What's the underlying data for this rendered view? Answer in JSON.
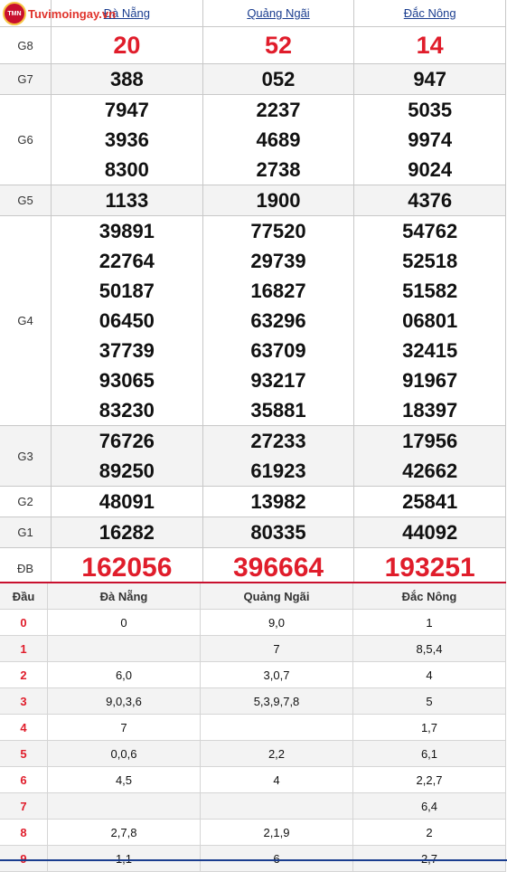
{
  "logo": {
    "text": "Tuvimoingay.vn",
    "badge": "TMN"
  },
  "provinces": [
    "Đà Nẵng",
    "Quảng Ngãi",
    "Đắc Nông"
  ],
  "prizes": [
    {
      "label": "G8",
      "values": [
        [
          "20"
        ],
        [
          "52"
        ],
        [
          "14"
        ]
      ]
    },
    {
      "label": "G7",
      "values": [
        [
          "388"
        ],
        [
          "052"
        ],
        [
          "947"
        ]
      ]
    },
    {
      "label": "G6",
      "values": [
        [
          "7947",
          "3936",
          "8300"
        ],
        [
          "2237",
          "4689",
          "2738"
        ],
        [
          "5035",
          "9974",
          "9024"
        ]
      ]
    },
    {
      "label": "G5",
      "values": [
        [
          "1133"
        ],
        [
          "1900"
        ],
        [
          "4376"
        ]
      ]
    },
    {
      "label": "G4",
      "values": [
        [
          "39891",
          "22764",
          "50187",
          "06450",
          "37739",
          "93065",
          "83230"
        ],
        [
          "77520",
          "29739",
          "16827",
          "63296",
          "63709",
          "93217",
          "35881"
        ],
        [
          "54762",
          "52518",
          "51582",
          "06801",
          "32415",
          "91967",
          "18397"
        ]
      ]
    },
    {
      "label": "G3",
      "values": [
        [
          "76726",
          "89250"
        ],
        [
          "27233",
          "61923"
        ],
        [
          "17956",
          "42662"
        ]
      ]
    },
    {
      "label": "G2",
      "values": [
        [
          "48091"
        ],
        [
          "13982"
        ],
        [
          "25841"
        ]
      ]
    },
    {
      "label": "G1",
      "values": [
        [
          "16282"
        ],
        [
          "80335"
        ],
        [
          "44092"
        ]
      ]
    },
    {
      "label": "ĐB",
      "values": [
        [
          "162056"
        ],
        [
          "396664"
        ],
        [
          "193251"
        ]
      ]
    }
  ],
  "loto": {
    "header": [
      "Đầu",
      "Đà Nẵng",
      "Quảng Ngãi",
      "Đắc Nông"
    ],
    "rows": [
      {
        "dau": "0",
        "values": [
          "0",
          "9,0",
          "1"
        ]
      },
      {
        "dau": "1",
        "values": [
          "",
          "7",
          "8,5,4"
        ]
      },
      {
        "dau": "2",
        "values": [
          "6,0",
          "3,0,7",
          "4"
        ]
      },
      {
        "dau": "3",
        "values": [
          "9,0,3,6",
          "5,3,9,7,8",
          "5"
        ]
      },
      {
        "dau": "4",
        "values": [
          "7",
          "",
          "1,7"
        ]
      },
      {
        "dau": "5",
        "values": [
          "0,0,6",
          "2,2",
          "6,1"
        ]
      },
      {
        "dau": "6",
        "values": [
          "4,5",
          "4",
          "2,2,7"
        ]
      },
      {
        "dau": "7",
        "values": [
          "",
          "",
          "6,4"
        ]
      },
      {
        "dau": "8",
        "values": [
          "2,7,8",
          "2,1,9",
          "2"
        ]
      },
      {
        "dau": "9",
        "values": [
          "1,1",
          "6",
          "2,7"
        ]
      }
    ]
  },
  "colors": {
    "accent_red": "#e01d2b",
    "link_blue": "#1a3d8f"
  }
}
